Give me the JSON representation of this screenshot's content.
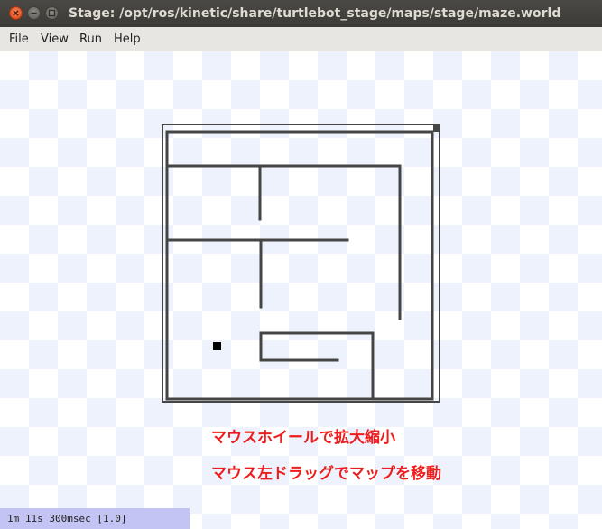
{
  "window": {
    "title": "Stage: /opt/ros/kinetic/share/turtlebot_stage/maps/stage/maze.world"
  },
  "menu": {
    "file": "File",
    "view": "View",
    "run": "Run",
    "help": "Help"
  },
  "canvas": {
    "hint_zoom": "マウスホイールで拡大縮小",
    "hint_pan": "マウス左ドラッグでマップを移動",
    "colors": {
      "wall": "#454545",
      "hint": "#ee1d1d",
      "status_bg": "#c4c4f4"
    }
  },
  "status": {
    "text": "1m 11s 300msec [1.0]"
  },
  "icons": [
    "close-icon",
    "minimize-icon",
    "maximize-icon"
  ]
}
